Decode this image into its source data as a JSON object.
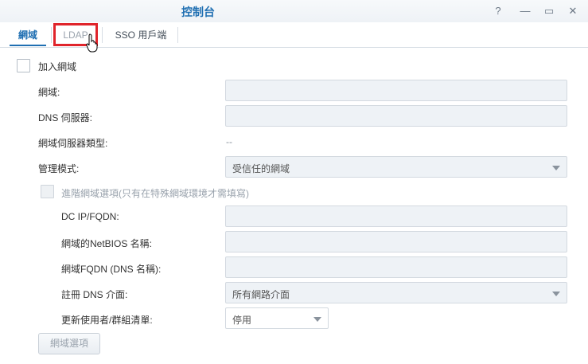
{
  "window": {
    "title": "控制台",
    "help_icon": "?",
    "minimize_icon": "—",
    "maximize_icon": "▭",
    "close_icon": "✕"
  },
  "tabs": [
    {
      "label": "網域",
      "active": true
    },
    {
      "label": "LDAP",
      "active": false
    },
    {
      "label": "SSO 用戶端",
      "active": false
    }
  ],
  "form": {
    "join_domain_label": "加入網域",
    "domain_label": "網域:",
    "dns_server_label": "DNS 伺服器:",
    "domain_server_type_label": "網域伺服器類型:",
    "domain_server_type_value": "--",
    "management_mode_label": "管理模式:",
    "management_mode_value": "受信任的網域",
    "advanced_label": "進階網域選項(只有在特殊網域環境才需填寫)",
    "dc_label": "DC IP/FQDN:",
    "netbios_label": "網域的NetBIOS 名稱:",
    "fqdn_label": "網域FQDN (DNS 名稱):",
    "register_dns_label": "註冊 DNS 介面:",
    "register_dns_value": "所有網路介面",
    "update_list_label": "更新使用者/群組清單:",
    "update_list_value": "停用",
    "domain_options_button": "網域選項"
  },
  "colors": {
    "accent": "#1f6fb2",
    "highlight_box": "#e0242b"
  }
}
